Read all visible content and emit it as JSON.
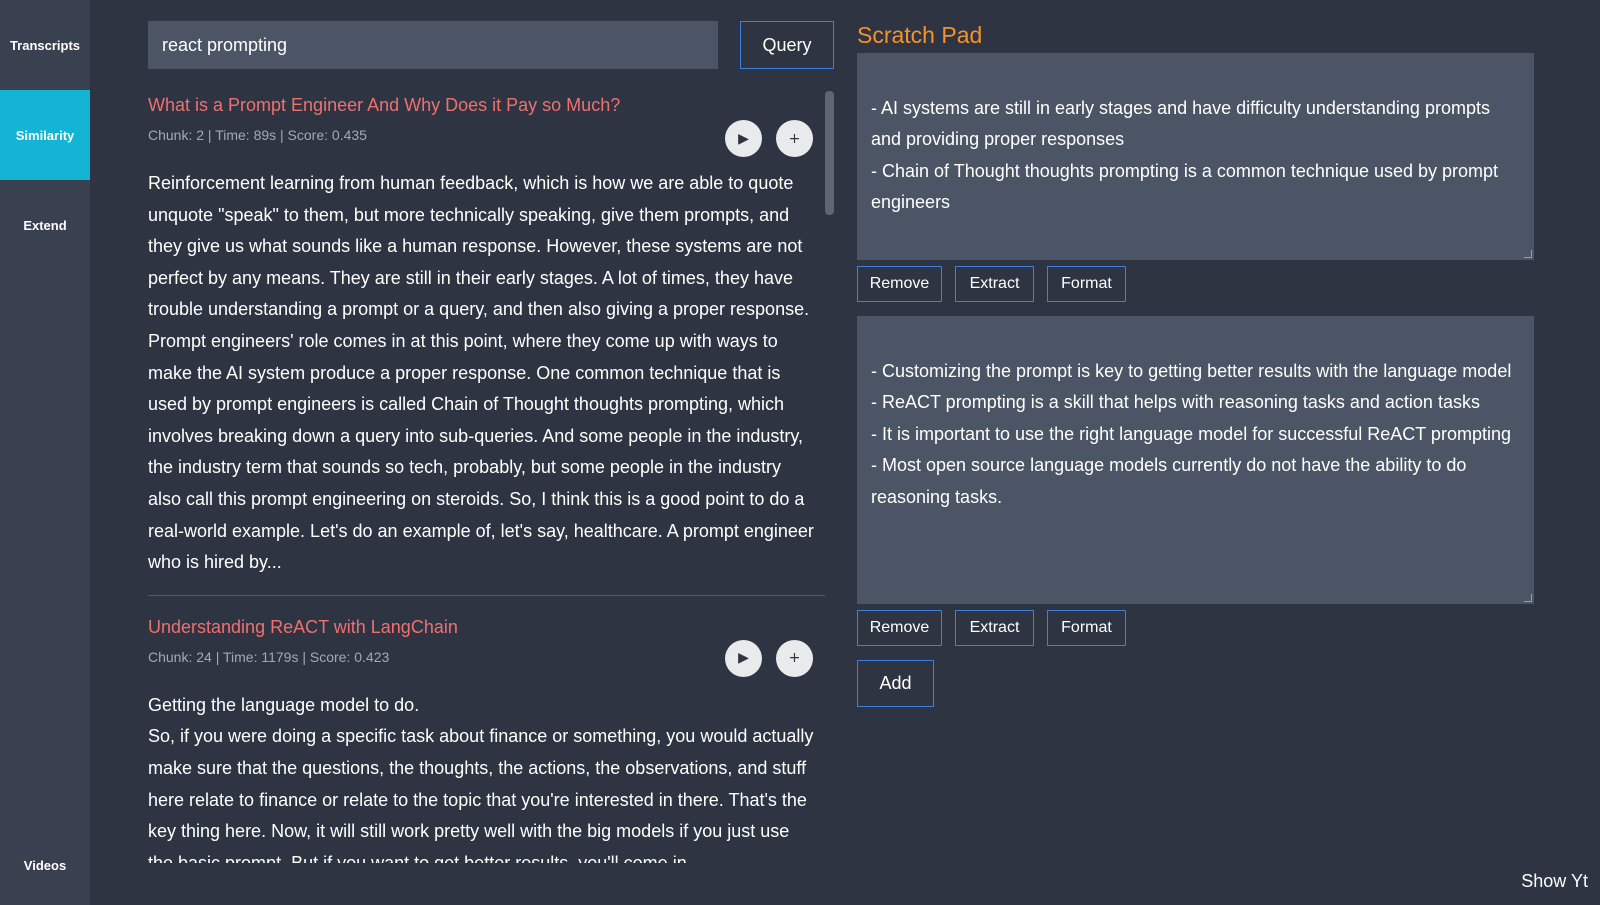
{
  "sidebar": {
    "items": [
      {
        "label": "Transcripts"
      },
      {
        "label": "Similarity"
      },
      {
        "label": "Extend"
      },
      {
        "label": "Videos"
      }
    ]
  },
  "search": {
    "value": "react prompting",
    "button_label": "Query"
  },
  "results": [
    {
      "title": "What is a Prompt Engineer And Why Does it Pay so Much?",
      "meta": "Chunk: 2 | Time: 89s | Score: 0.435",
      "play_icon": "▶",
      "add_icon": "+",
      "text": "Reinforcement learning from human feedback, which is how we are able to quote unquote \"speak\" to them, but more technically speaking, give them prompts, and they give us what sounds like a human response. However, these systems are not perfect by any means. They are still in their early stages. A lot of times, they have trouble understanding a prompt or a query, and then also giving a proper response. Prompt engineers' role comes in at this point, where they come up with ways to make the AI system produce a proper response. One common technique that is used by prompt engineers is called Chain of Thought thoughts prompting, which involves breaking down a query into sub-queries. And some people in the industry, the industry term that sounds so tech, probably, but some people in the industry also call this prompt engineering on steroids. So, I think this is a good point to do a real-world example. Let's do an example of, let's say, healthcare. A prompt engineer who is hired by..."
    },
    {
      "title": "Understanding ReACT with LangChain",
      "meta": "Chunk: 24 | Time: 1179s | Score: 0.423",
      "play_icon": "▶",
      "add_icon": "+",
      "text": "Getting the language model to do.\nSo, if you were doing a specific task about finance or something, you would actually make sure that the questions, the thoughts, the actions, the observations, and stuff here relate to finance or relate to the topic that you're interested in there. That's the key thing here. Now, it will still work pretty well with the big models if you just use the basic prompt. But if you want to get better results, you'll come in"
    }
  ],
  "scratch_pad": {
    "title": "Scratch Pad",
    "notes": [
      {
        "text": "- AI systems are still in early stages and have difficulty understanding prompts and providing proper responses\n- Chain of Thought thoughts prompting is a common technique used by prompt engineers",
        "remove_label": "Remove",
        "extract_label": "Extract",
        "format_label": "Format"
      },
      {
        "text": "- Customizing the prompt is key to getting better results with the language model\n- ReACT prompting is a skill that helps with reasoning tasks and action tasks\n- It is important to use the right language model for successful ReACT prompting\n- Most open source language models currently do not have the ability to do reasoning tasks.",
        "remove_label": "Remove",
        "extract_label": "Extract",
        "format_label": "Format"
      }
    ],
    "add_label": "Add"
  },
  "footer": {
    "show_yt_label": "Show Yt"
  },
  "colors": {
    "background": "#2e3441",
    "sidebar": "#394150",
    "active_nav": "#14b4d4",
    "result_title": "#f07070",
    "scratch_title": "#f5922d",
    "button_border": "#3c82dc"
  }
}
